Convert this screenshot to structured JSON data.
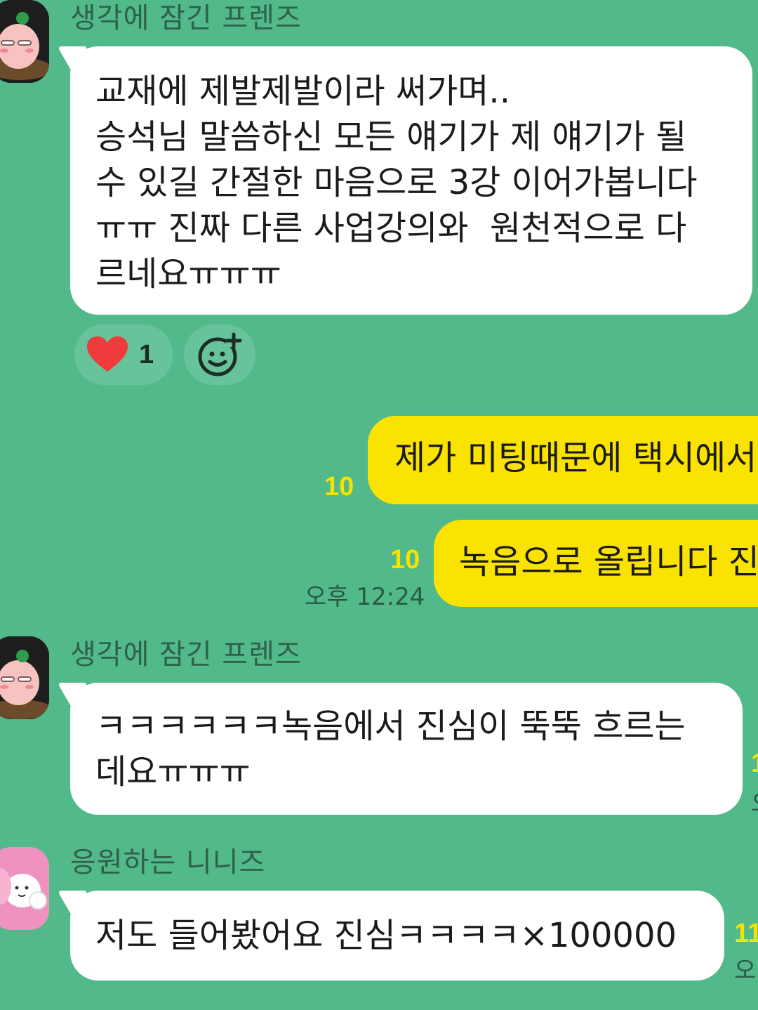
{
  "messages": [
    {
      "sender": "생각에 잠긴 프렌즈",
      "text": "교재에 제발제발이라 써가며..\n승석님 말씀하신 모든 얘기가 제 얘기가 될\n수 있길 간절한 마음으로 3강 이어가봅니다\nㅠㅠ 진짜 다른 사업강의와  원천적으로 다\n르네요ㅠㅠㅠ",
      "reaction": {
        "icon": "heart-icon",
        "count": "1"
      }
    },
    {
      "text": "제가 미팅때문에 택시에서",
      "unread": "10"
    },
    {
      "text": "녹음으로 올립니다 진",
      "unread": "10",
      "time": "오후 12:24"
    },
    {
      "sender": "생각에 잠긴 프렌즈",
      "text": "ㅋㅋㅋㅋㅋㅋ녹음에서 진심이 뚝뚝 흐르는\n데요ㅠㅠㅠ",
      "edge_unread": "1",
      "edge_time": "오"
    },
    {
      "sender": "응원하는 니니즈",
      "text": "저도 들어봤어요 진심ㅋㅋㅋㅋ×100000",
      "edge_unread": "11",
      "edge_time": "오"
    }
  ],
  "colors": {
    "background": "#52b98a",
    "bubble_in": "#ffffff",
    "bubble_out": "#fae300",
    "unread": "#f6e300",
    "heart": "#ef3b3b"
  }
}
